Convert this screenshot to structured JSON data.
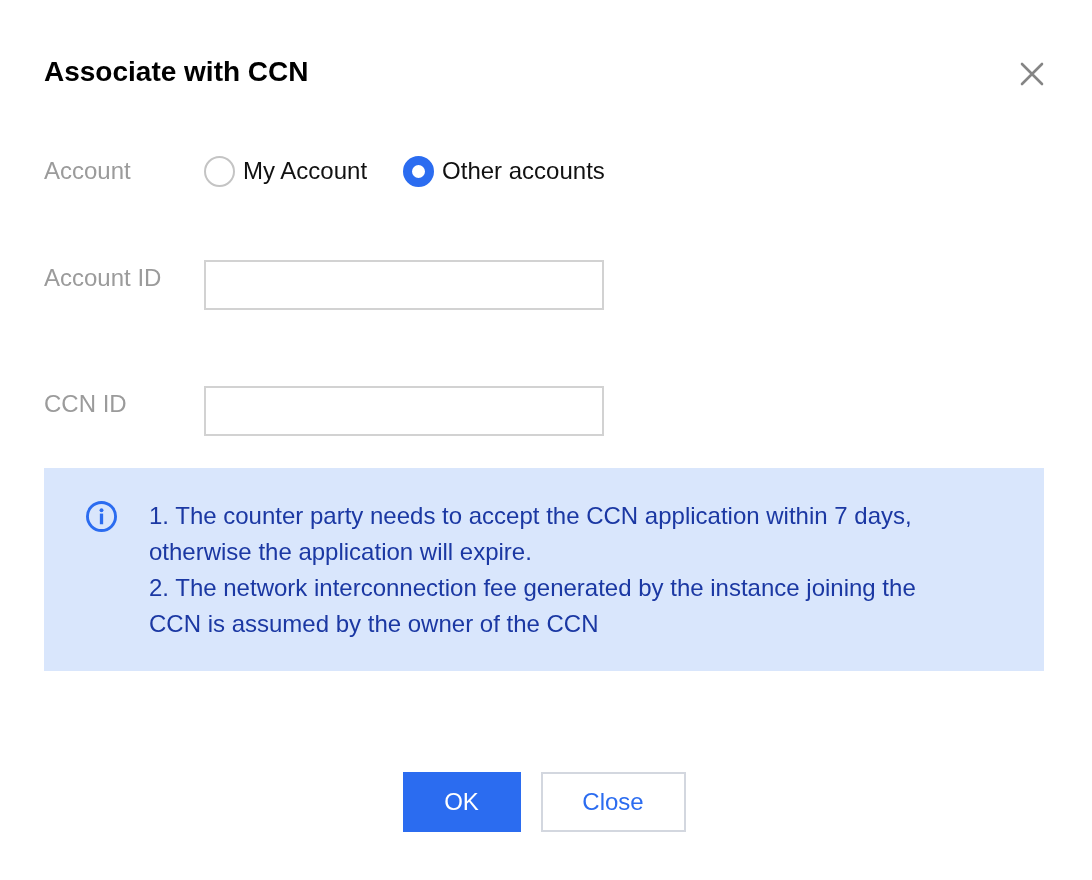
{
  "dialog": {
    "title": "Associate with CCN"
  },
  "account": {
    "label": "Account",
    "options": [
      {
        "label": "My Account",
        "selected": false
      },
      {
        "label": "Other accounts",
        "selected": true
      }
    ]
  },
  "fields": [
    {
      "label": "Account ID"
    },
    {
      "label": "CCN ID"
    }
  ],
  "notice": {
    "items": [
      "1. The counter party needs to accept the CCN application within 7 days, otherwise the application will expire.",
      "2. The network interconnection fee generated by the instance joining the CCN is assumed by the owner of the CCN"
    ]
  },
  "buttons": [
    {
      "label": "OK",
      "kind": "primary"
    },
    {
      "label": "Close",
      "kind": "secondary"
    }
  ]
}
